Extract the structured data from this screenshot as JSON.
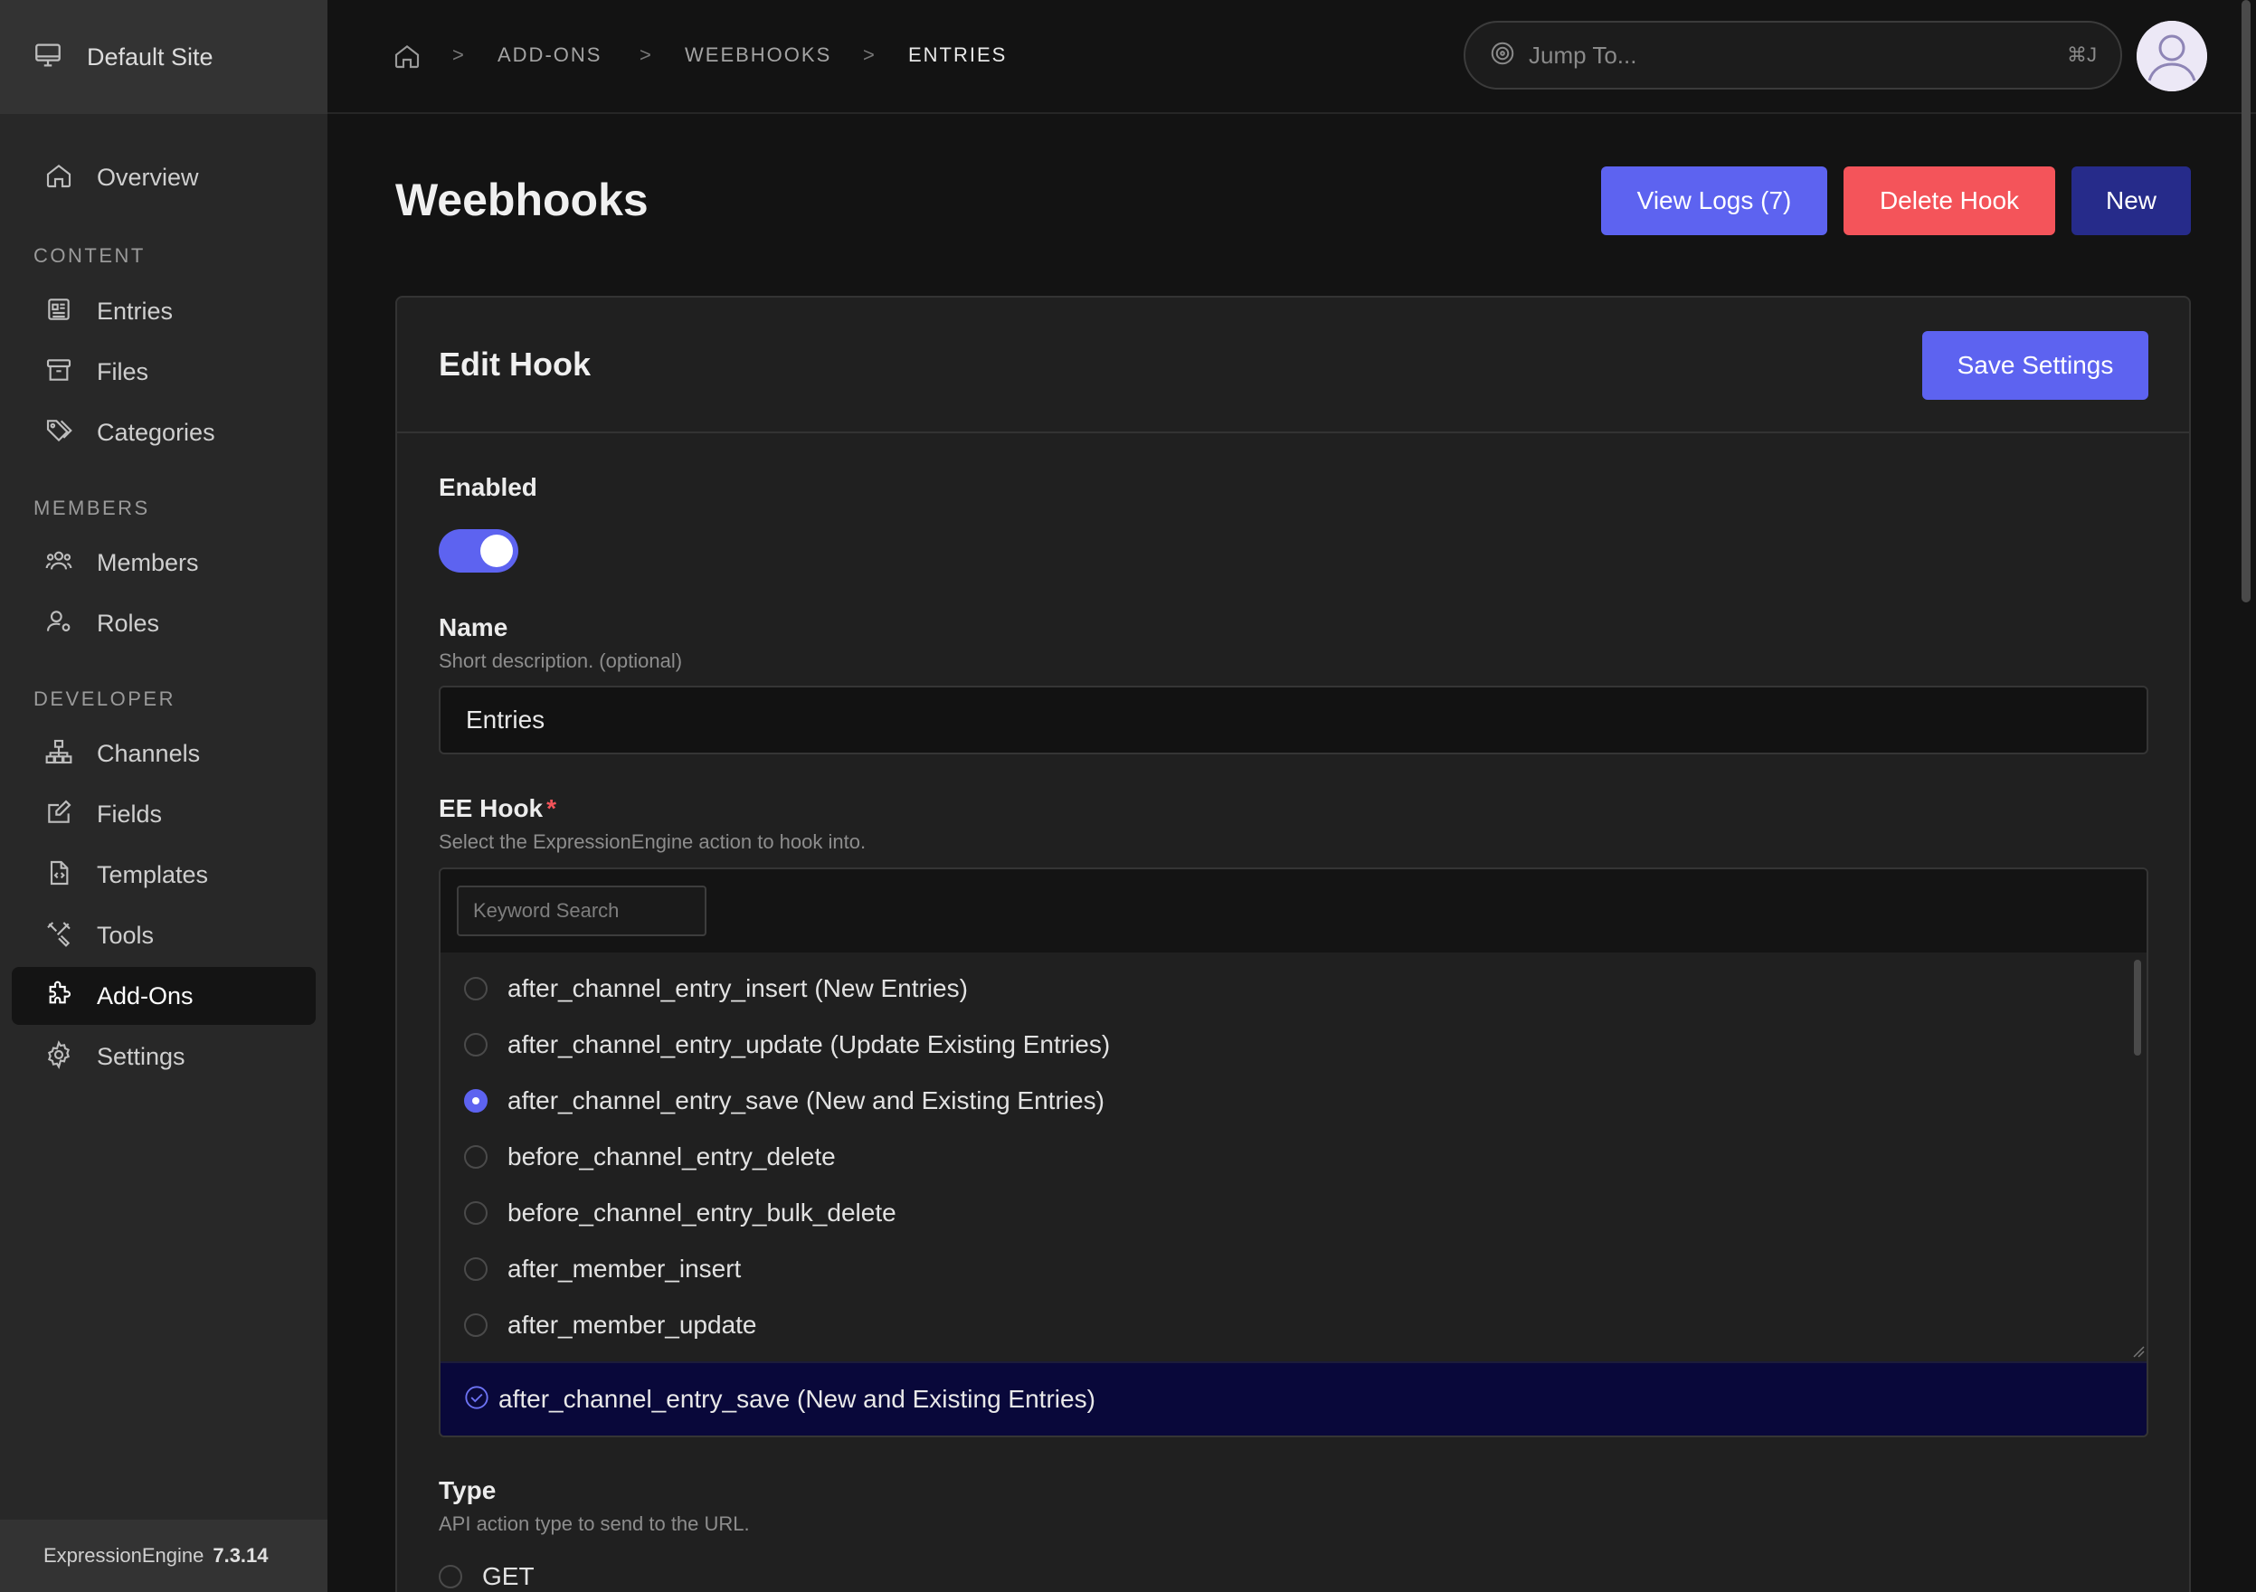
{
  "sidebar": {
    "site_name": "Default Site",
    "overview": "Overview",
    "sections": {
      "content": "CONTENT",
      "members": "MEMBERS",
      "developer": "DEVELOPER"
    },
    "items": {
      "entries": "Entries",
      "files": "Files",
      "categories": "Categories",
      "members": "Members",
      "roles": "Roles",
      "channels": "Channels",
      "fields": "Fields",
      "templates": "Templates",
      "tools": "Tools",
      "addons": "Add-Ons",
      "settings": "Settings"
    },
    "active_item": "Add-Ons",
    "footer": {
      "product": "ExpressionEngine",
      "version": "7.3.14"
    }
  },
  "topbar": {
    "breadcrumbs": [
      "ADD-ONS",
      "WEEBHOOKS",
      "ENTRIES"
    ],
    "separator": ">",
    "search_placeholder": "Jump To...",
    "shortcut": "⌘J"
  },
  "page": {
    "title": "Weebhooks",
    "buttons": {
      "view_logs": "View Logs (7)",
      "delete_hook": "Delete Hook",
      "new": "New"
    }
  },
  "form": {
    "title": "Edit Hook",
    "save_label": "Save Settings",
    "enabled": {
      "label": "Enabled",
      "value": true
    },
    "name": {
      "label": "Name",
      "description": "Short description. (optional)",
      "value": "Entries"
    },
    "ee_hook": {
      "label": "EE Hook",
      "required_mark": "*",
      "description": "Select the ExpressionEngine action to hook into.",
      "search_placeholder": "Keyword Search",
      "options": [
        "after_channel_entry_insert (New Entries)",
        "after_channel_entry_update (Update Existing Entries)",
        "after_channel_entry_save (New and Existing Entries)",
        "before_channel_entry_delete",
        "before_channel_entry_bulk_delete",
        "after_member_insert",
        "after_member_update"
      ],
      "selected": "after_channel_entry_save (New and Existing Entries)"
    },
    "type": {
      "label": "Type",
      "description": "API action type to send to the URL.",
      "options": [
        "GET"
      ]
    }
  },
  "colors": {
    "accent": "#5d63f0",
    "danger": "#f4545a",
    "dark_primary": "#262b8a",
    "selected_bg": "#09083a"
  }
}
